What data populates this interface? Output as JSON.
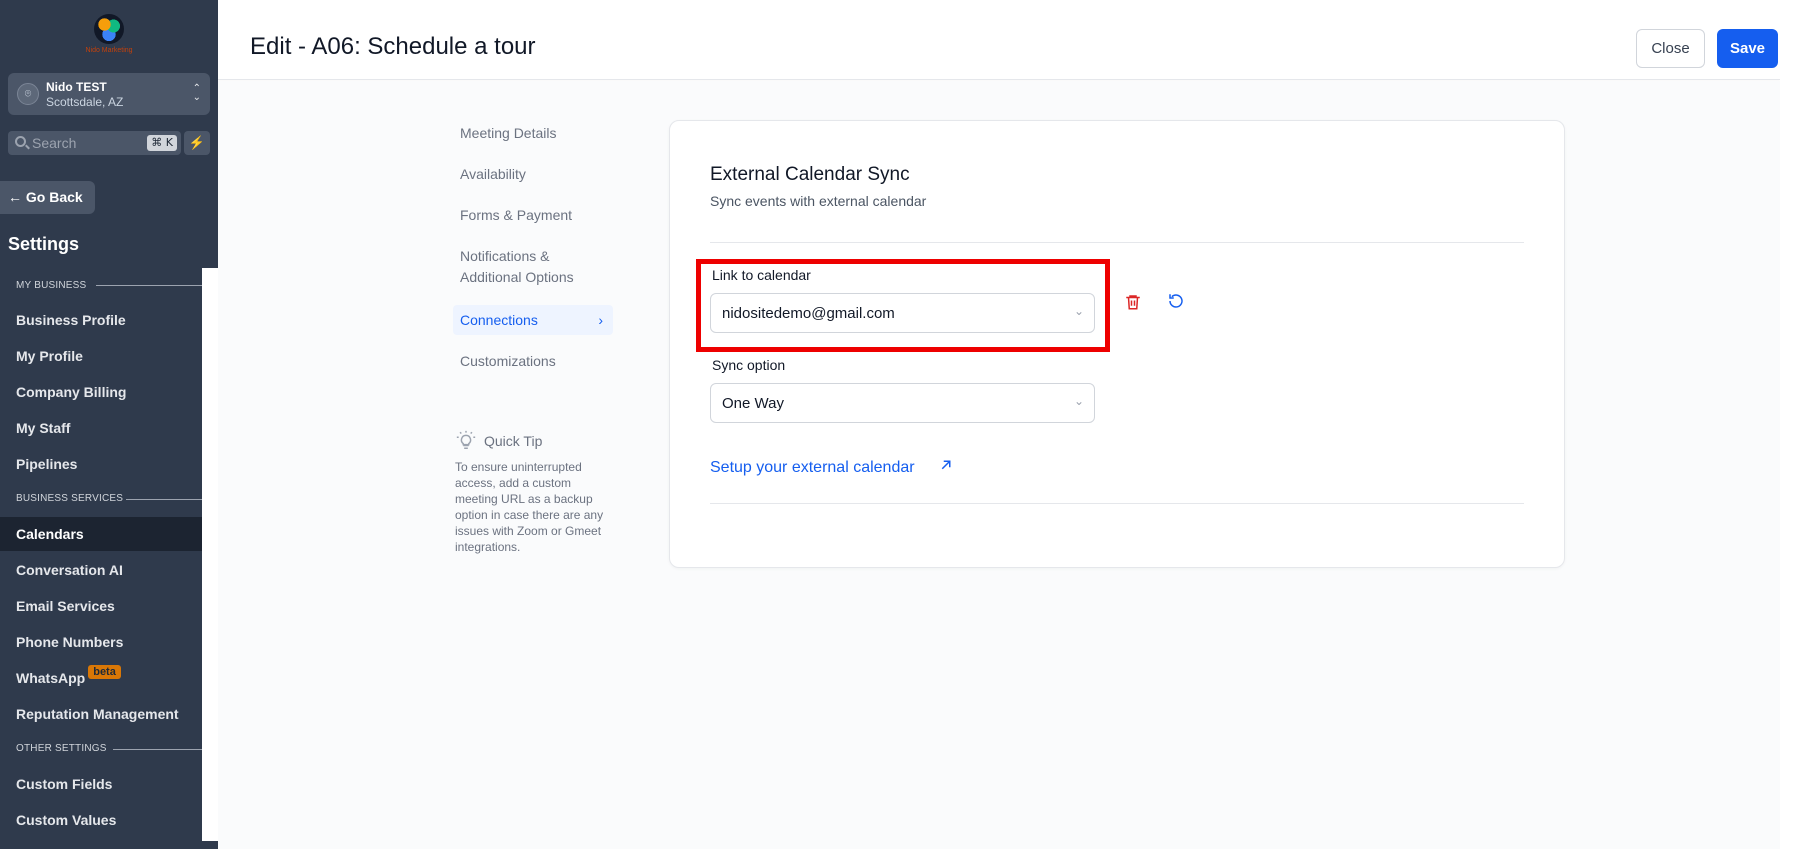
{
  "sidebar": {
    "logo_text": "Nido Marketing",
    "location": {
      "name": "Nido TEST",
      "address": "Scottsdale, AZ"
    },
    "search": {
      "placeholder": "Search",
      "shortcut": "⌘ K"
    },
    "go_back": "Go Back",
    "title": "Settings",
    "sections": {
      "my_business": "MY BUSINESS",
      "business_services": "BUSINESS SERVICES",
      "other_settings": "OTHER SETTINGS"
    },
    "items": [
      {
        "label": "Business Profile"
      },
      {
        "label": "My Profile"
      },
      {
        "label": "Company Billing"
      },
      {
        "label": "My Staff"
      },
      {
        "label": "Pipelines"
      },
      {
        "label": "Calendars",
        "active": true
      },
      {
        "label": "Conversation AI"
      },
      {
        "label": "Email Services"
      },
      {
        "label": "Phone Numbers"
      },
      {
        "label": "WhatsApp",
        "badge": "beta"
      },
      {
        "label": "Reputation Management"
      },
      {
        "label": "Custom Fields"
      },
      {
        "label": "Custom Values"
      }
    ]
  },
  "header": {
    "title": "Edit - A06: Schedule a tour",
    "close_label": "Close",
    "save_label": "Save"
  },
  "subnav": {
    "items": [
      {
        "label": "Meeting Details"
      },
      {
        "label": "Availability"
      },
      {
        "label": "Forms & Payment"
      },
      {
        "label": "Notifications & Additional Options"
      },
      {
        "label": "Connections",
        "active": true
      },
      {
        "label": "Customizations"
      }
    ],
    "tip_title": "Quick Tip",
    "tip_text": "To ensure uninterrupted access, add a custom meeting URL as a backup option in case there are any issues with Zoom or Gmeet integrations."
  },
  "card": {
    "title": "External Calendar Sync",
    "subtitle": "Sync events with external calendar",
    "link_label": "Link to calendar",
    "link_value": "nidositedemo@gmail.com",
    "sync_label": "Sync option",
    "sync_value": "One Way",
    "setup_link": "Setup your external calendar"
  },
  "colors": {
    "primary": "#155eef",
    "sidebar_bg": "#2f3a4c",
    "highlight": "#ee0000",
    "delete": "#dc2626"
  }
}
